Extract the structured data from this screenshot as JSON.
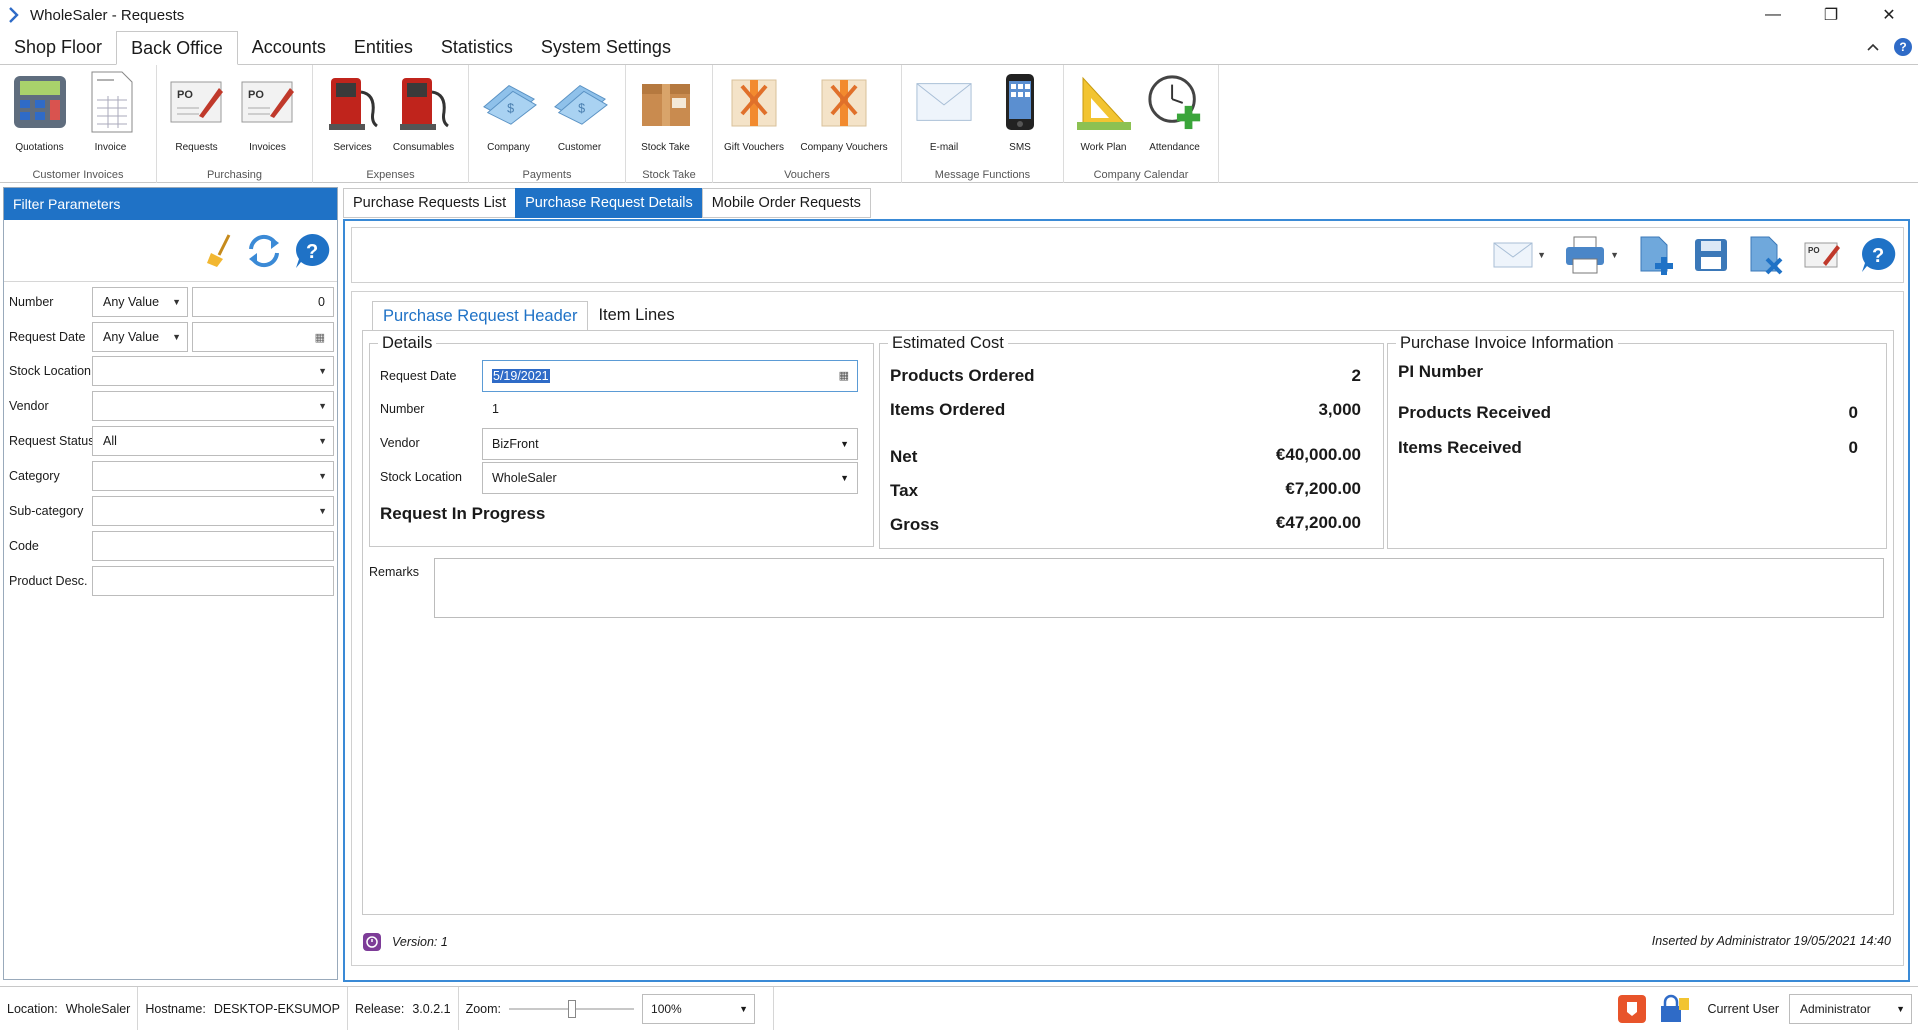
{
  "window": {
    "title": "WholeSaler - Requests",
    "minimize": "—",
    "restore": "❐",
    "close": "✕"
  },
  "ribbon_tabs": [
    "Shop Floor",
    "Back Office",
    "Accounts",
    "Entities",
    "Statistics",
    "System Settings"
  ],
  "ribbon_groups": [
    {
      "label": "Customer Invoices",
      "items": [
        {
          "label": "Quotations",
          "icon": "calculator-icon"
        },
        {
          "label": "Invoice",
          "icon": "invoice-icon"
        }
      ]
    },
    {
      "label": "Purchasing",
      "items": [
        {
          "label": "Requests",
          "icon": "po-requests-icon"
        },
        {
          "label": "Invoices",
          "icon": "po-invoices-icon"
        }
      ]
    },
    {
      "label": "Expenses",
      "items": [
        {
          "label": "Services",
          "icon": "fuel-pump-icon"
        },
        {
          "label": "Consumables",
          "icon": "fuel-pump-icon"
        }
      ]
    },
    {
      "label": "Payments",
      "items": [
        {
          "label": "Company",
          "icon": "banknote-icon"
        },
        {
          "label": "Customer",
          "icon": "banknote-icon"
        }
      ]
    },
    {
      "label": "Stock Take",
      "items": [
        {
          "label": "Stock Take",
          "icon": "box-icon"
        }
      ]
    },
    {
      "label": "Vouchers",
      "items": [
        {
          "label": "Gift Vouchers",
          "icon": "gift-icon"
        },
        {
          "label": "Company Vouchers",
          "icon": "gift-icon"
        }
      ]
    },
    {
      "label": "Message Functions",
      "items": [
        {
          "label": "E-mail",
          "icon": "envelope-icon"
        },
        {
          "label": "SMS",
          "icon": "phone-icon"
        }
      ]
    },
    {
      "label": "Company Calendar",
      "items": [
        {
          "label": "Work Plan",
          "icon": "set-square-icon"
        },
        {
          "label": "Attendance",
          "icon": "clock-add-icon"
        }
      ]
    }
  ],
  "filter": {
    "title": "Filter Parameters",
    "rows": [
      {
        "label": "Number",
        "select": "Any Value",
        "input": "0"
      },
      {
        "label": "Request Date",
        "select": "Any Value",
        "input": ""
      },
      {
        "label": "Stock Location",
        "value": ""
      },
      {
        "label": "Vendor",
        "value": ""
      },
      {
        "label": "Request Status",
        "value": "All"
      },
      {
        "label": "Category",
        "value": ""
      },
      {
        "label": "Sub-category",
        "value": ""
      },
      {
        "label": "Code",
        "value": ""
      },
      {
        "label": "Product Desc.",
        "value": ""
      }
    ]
  },
  "main_tabs": [
    "Purchase Requests List",
    "Purchase Request Details",
    "Mobile Order Requests"
  ],
  "inner_tabs": [
    "Purchase Request Header",
    "Item Lines"
  ],
  "details": {
    "title": "Details",
    "request_date_label": "Request Date",
    "request_date": "5/19/2021",
    "number_label": "Number",
    "number": "1",
    "vendor_label": "Vendor",
    "vendor": "BizFront",
    "stock_location_label": "Stock Location",
    "stock_location": "WholeSaler",
    "status": "Request In Progress"
  },
  "estimated_cost": {
    "title": "Estimated Cost",
    "products_ordered_label": "Products Ordered",
    "products_ordered": "2",
    "items_ordered_label": "Items Ordered",
    "items_ordered": "3,000",
    "net_label": "Net",
    "net": "€40,000.00",
    "tax_label": "Tax",
    "tax": "€7,200.00",
    "gross_label": "Gross",
    "gross": "€47,200.00"
  },
  "purchase_invoice": {
    "title": "Purchase Invoice Information",
    "pi_number_label": "PI Number",
    "products_received_label": "Products Received",
    "products_received": "0",
    "items_received_label": "Items Received",
    "items_received": "0"
  },
  "remarks_label": "Remarks",
  "remarks": "",
  "version": "Version:  1",
  "inserted": "Inserted by Administrator 19/05/2021 14:40",
  "status_bar": {
    "location_label": "Location:",
    "location": "WholeSaler",
    "hostname_label": "Hostname:",
    "hostname": "DESKTOP-EKSUMOP",
    "release_label": "Release:",
    "release": "3.0.2.1",
    "zoom_label": "Zoom:",
    "zoom": "100%",
    "zoom_level": 0.5,
    "current_user_label": "Current User",
    "current_user": "Administrator"
  },
  "colors": {
    "accent": "#1f72c6",
    "frame_border": "#3a8ad6"
  }
}
